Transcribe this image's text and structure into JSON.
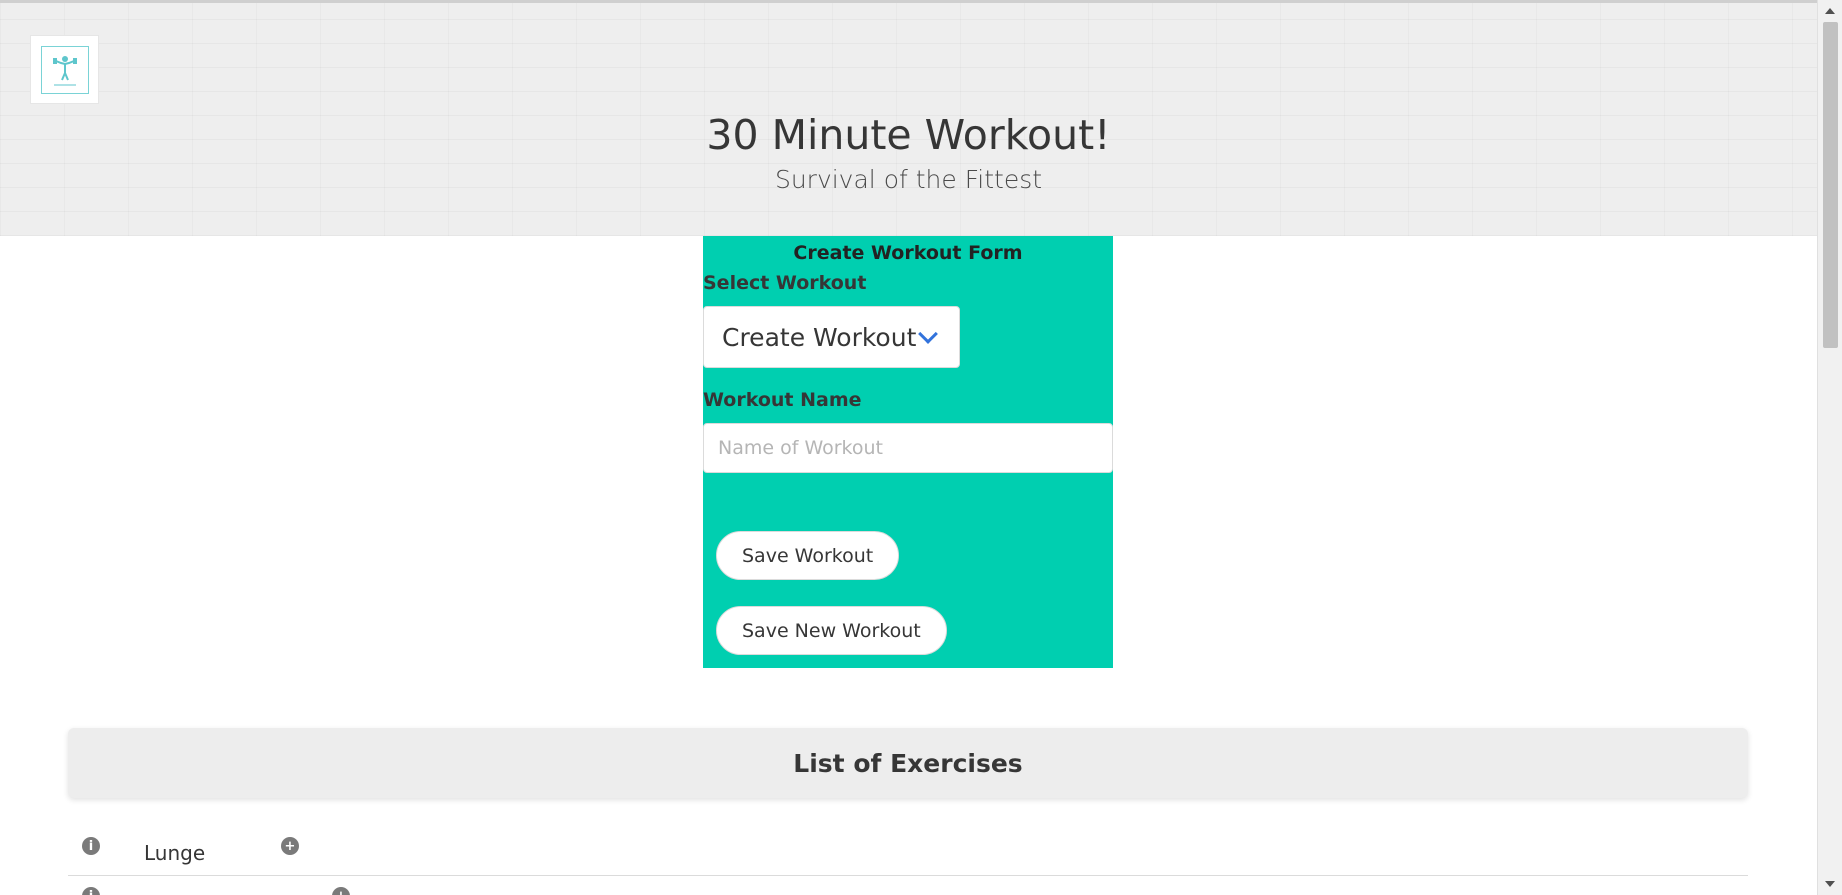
{
  "header": {
    "title": "30 Minute Workout!",
    "subtitle": "Survival of the Fittest",
    "logo_icon": "fitness-figure-icon",
    "logo_caption": "Survival of the Fittest"
  },
  "form": {
    "title": "Create Workout Form",
    "select_label": "Select Workout",
    "select_value": "Create Workout",
    "name_label": "Workout Name",
    "name_placeholder": "Name of Workout",
    "name_value": "",
    "save_button": "Save Workout",
    "save_new_button": "Save New Workout",
    "accent_color": "#00cfb0",
    "chevron_color": "#3273dc"
  },
  "exercises": {
    "title": "List of Exercises",
    "items": [
      {
        "name": "Lunge",
        "info_icon": "info-circle-icon",
        "add_icon": "plus-circle-icon"
      }
    ]
  }
}
